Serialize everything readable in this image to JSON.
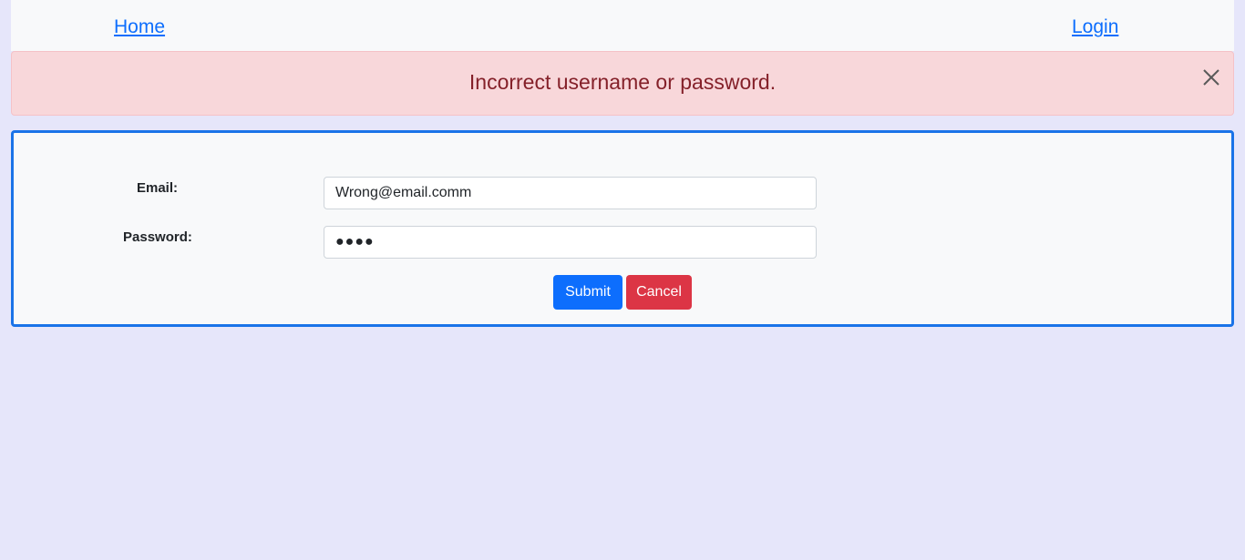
{
  "nav": {
    "home_label": "Home",
    "login_label": "Login"
  },
  "alert": {
    "message": "Incorrect username or password.",
    "close_icon": "close-icon"
  },
  "form": {
    "email_label": "Email:",
    "email_value": "Wrong@email.comm",
    "password_label": "Password:",
    "password_value": "●●●●",
    "submit_label": "Submit",
    "cancel_label": "Cancel"
  },
  "colors": {
    "page_bg": "#e6e6fa",
    "alert_bg": "#f8d7da",
    "alert_text": "#842029",
    "link": "#0d6efd",
    "submit": "#0d6efd",
    "cancel": "#dc3545",
    "form_border": "#1a73e8"
  }
}
